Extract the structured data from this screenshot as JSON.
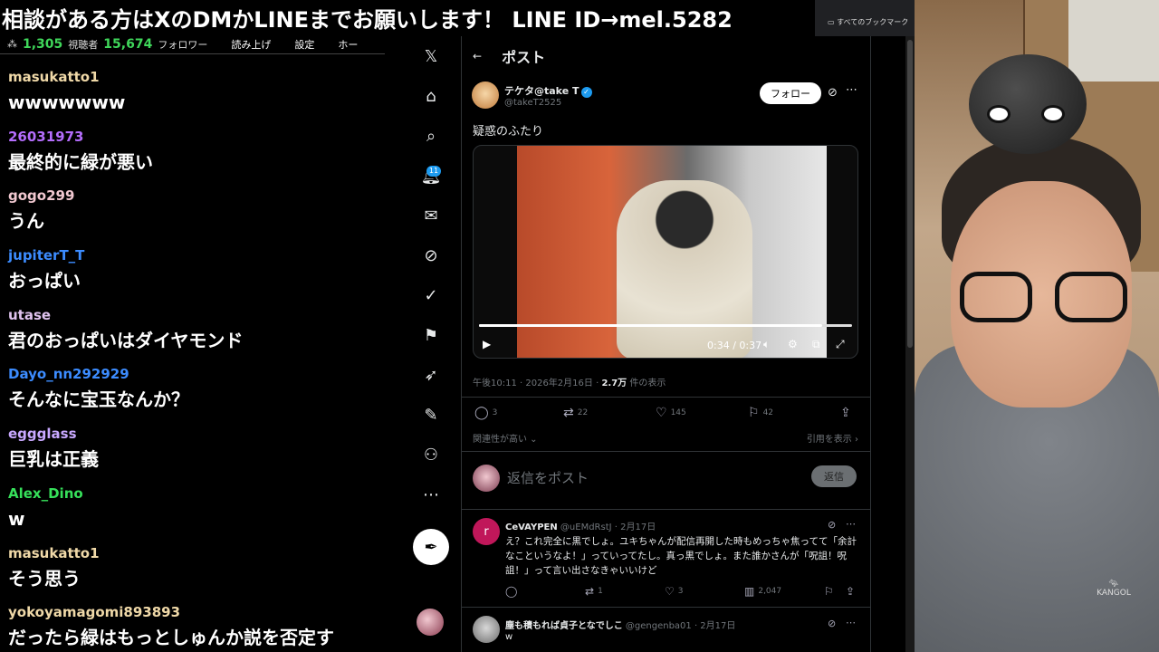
{
  "banner": "相談がある方はXのDMかLINEまでお願いします！ LINE ID→mel.5282",
  "chat_header": {
    "viewers": "1,305",
    "viewers_label": "視聴者",
    "followers": "15,674",
    "followers_label": "フォロワー",
    "links": [
      "読み上げ",
      "設定",
      "ホー"
    ]
  },
  "chat": [
    {
      "user": "masukatto1",
      "text": "wwwwwww",
      "color": "#f0d9a8"
    },
    {
      "user": "26031973",
      "text": "最終的に緑が悪い",
      "color": "#b46dfc"
    },
    {
      "user": "gogo299",
      "text": "うん",
      "color": "#f1c8d0"
    },
    {
      "user": "jupiterT_T",
      "text": "おっぱい",
      "color": "#3c8cff"
    },
    {
      "user": "utase",
      "text": "君のおっぱいはダイヤモンド",
      "color": "#e0c3ef"
    },
    {
      "user": "Dayo_nn292929",
      "text": "そんなに宝玉なんか？",
      "color": "#3c8cff"
    },
    {
      "user": "eggglass",
      "text": "巨乳は正義",
      "color": "#c8a8ff"
    },
    {
      "user": "Alex_Dino",
      "text": "w",
      "color": "#36e05a"
    },
    {
      "user": "masukatto1",
      "text": "そう思う",
      "color": "#f0d9a8"
    },
    {
      "user": "yokoyamagomi893893",
      "text": "だったら緑はもっとしゅんか説を否定す",
      "color": "#f0d9a8"
    }
  ],
  "x": {
    "nav": {
      "logo": "x-logo",
      "badge": "11"
    },
    "post_title": "ポスト",
    "author": {
      "name": "テケタ@take T",
      "handle": "@takeT2525"
    },
    "follow": "フォロー",
    "text": "疑惑のふたり",
    "video": {
      "time": "0:34 / 0:37",
      "progress": 0.92
    },
    "meta": {
      "date": "午後10:11 · 2026年2月16日 ·",
      "views": "2.7万",
      "views_suffix": "件の表示"
    },
    "actions": {
      "replies": "3",
      "reposts": "22",
      "likes": "145",
      "bookmarks": "42"
    },
    "sort_label": "関連性が高い ⌄",
    "quotes_label": "引用を表示 ›",
    "reply_placeholder": "返信をポスト",
    "reply_button": "返信",
    "comment1": {
      "avatar_letter": "r",
      "name": "CeVAYPEN",
      "handle": "@uEMdRstJ · 2月17日",
      "body": "え？これ完全に黒でしょ。ユキちゃんが配信再開した時もめっちゃ焦ってて「余計なこというなよ！」っていってたし。真っ黒でしょ。また誰かさんが「呪詛！呪詛！」って言い出さなきゃいいけど",
      "reposts": "1",
      "likes": "3",
      "views": "2,047"
    },
    "comment2": {
      "name": "塵も積もれば貞子となでしこ",
      "handle": "@gengenba01 · 2月17日",
      "body": "w"
    }
  },
  "browser": {
    "bookmarks_label": "すべてのブックマーク"
  },
  "cam": {
    "logo_text": "KANGOL"
  }
}
